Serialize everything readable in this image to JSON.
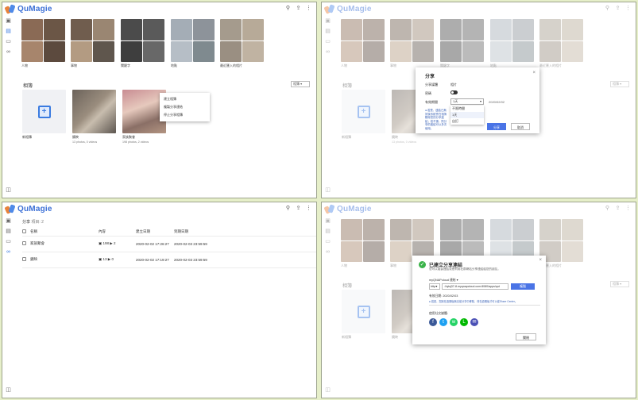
{
  "app": {
    "name": "QuMagie"
  },
  "header_icons": [
    "search-icon",
    "upload-icon",
    "more-icon"
  ],
  "rail_icons": [
    "photos-icon",
    "albums-icon",
    "folders-icon",
    "share-icon",
    "trash-icon"
  ],
  "categories": [
    {
      "label": "人物",
      "colors": [
        "#8a6a55",
        "#6b5646",
        "#a7856c",
        "#5c4a3e"
      ]
    },
    {
      "label": "事物",
      "colors": [
        "#705d4e",
        "#9a8672",
        "#b39b82",
        "#5f564d"
      ]
    },
    {
      "label": "關鍵字",
      "colors": [
        "#4b4b4b",
        "#5a5a5a",
        "#3e3e3e",
        "#686868"
      ]
    },
    {
      "label": "地點",
      "colors": [
        "#a4adb6",
        "#8d939a",
        "#b6bec6",
        "#7f8a8f"
      ]
    },
    {
      "label": "最近匯入的相片",
      "colors": [
        "#a59b8d",
        "#b7aa98",
        "#9a8f82",
        "#c0b3a2"
      ]
    }
  ],
  "albums_section": {
    "title": "相簿",
    "sort_label": "相簿"
  },
  "albums": [
    {
      "title": "新相簿",
      "subtitle": ""
    },
    {
      "title": "鏡映",
      "subtitle": "13 photos, 0 videos"
    },
    {
      "title": "家族聚會",
      "subtitle": "198 photos, 2 videos"
    }
  ],
  "context_menu": [
    "建立相簿",
    "複製分享連結",
    "停止分享相簿"
  ],
  "share_dialog": {
    "title": "分享",
    "share_media_label": "分享媒體",
    "share_media_value": "相片",
    "password_label": "密碼",
    "expire_label": "有效期間",
    "expire_value": "1天",
    "expire_date": "2020/02/02",
    "note": "若是，連結已無效後系統會在相簿刪除您的分享連結；若不選，則分享的連結可以多次使用。",
    "options": [
      "不限時間",
      "1天",
      "自訂"
    ],
    "ok": "分享",
    "cancel": "取消"
  },
  "share_page": {
    "title": "分享",
    "count_label": "項目: 2",
    "columns": [
      "名稱",
      "內容",
      "建立日期",
      "到期日期"
    ],
    "rows": [
      {
        "name": "家族聚會",
        "photos": "198",
        "videos": "2",
        "created": "2020-02-02 17:26:27",
        "expires": "2020-02-03 23:59:59"
      },
      {
        "name": "鏡映",
        "photos": "13",
        "videos": "0",
        "created": "2020-02-02 17:19:27",
        "expires": "2020-02-03 23:59:59"
      }
    ]
  },
  "created_dialog": {
    "title": "已建立分享連結",
    "subtitle": "您可以複製連結或是利用社群網站分享連結給您的朋友。",
    "link_type": "myQNAPcloud 連結",
    "protocol": "http",
    "url": "://qtoj37-8.myqnapcloud.com:8080/apps/qut",
    "copy": "複製",
    "expire_label": "有效日期:",
    "expire_value": "2020/02/03",
    "note": "若是，您將在過期後無法從分享中移除，僅在過期後才可以從Share Center。",
    "social_label": "使用社交媒體:",
    "close": "關閉"
  },
  "accent": "#4a74e6"
}
